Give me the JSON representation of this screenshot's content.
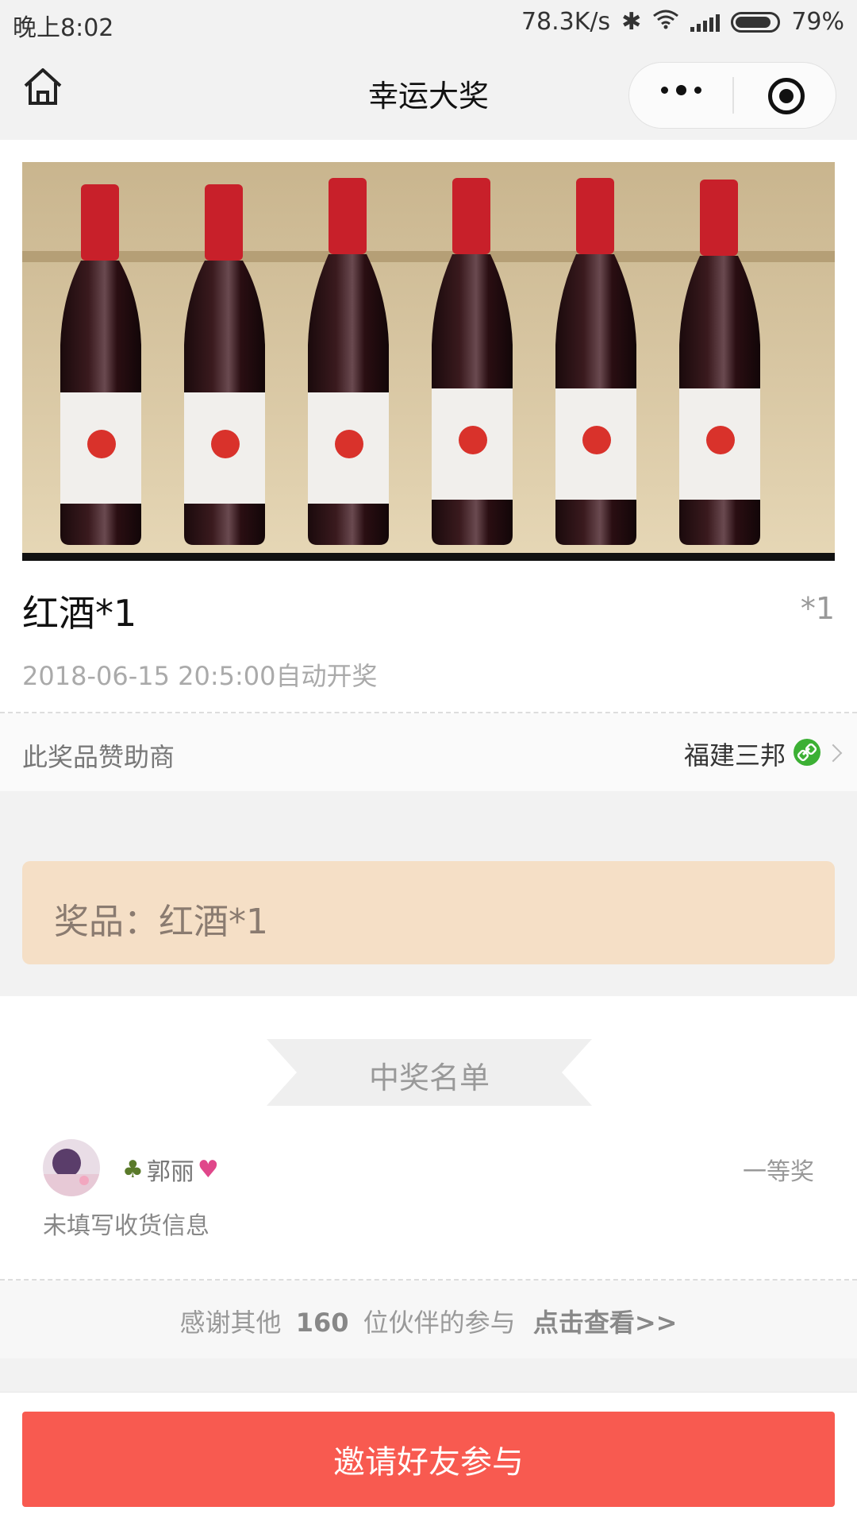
{
  "status_bar": {
    "time": "晚上8:02",
    "network_speed": "78.3K/s",
    "battery": "79%"
  },
  "nav": {
    "title": "幸运大奖",
    "icons": [
      "home-icon",
      "more-icon",
      "target-icon"
    ]
  },
  "prize": {
    "name": "红酒*1",
    "quantity": "*1",
    "draw_time": "2018-06-15 20:5:00自动开奖",
    "sponsor_label": "此奖品赞助商",
    "sponsor_name": "福建三邦",
    "banner_text": "奖品：红酒*1"
  },
  "winners": {
    "title": "中奖名单",
    "list": [
      {
        "name": "郭丽",
        "level": "一等奖",
        "address_status": "未填写收货信息"
      }
    ],
    "thanks_prefix": "感谢其他",
    "participant_count": "160",
    "thanks_suffix": "位伙伴的参与",
    "view_link": "点击查看>>"
  },
  "footer": {
    "invite_label": "邀请好友参与"
  },
  "colors": {
    "accent": "#f85a50",
    "banner": "#f5dfc6",
    "sponsor_icon": "#3cb034"
  }
}
